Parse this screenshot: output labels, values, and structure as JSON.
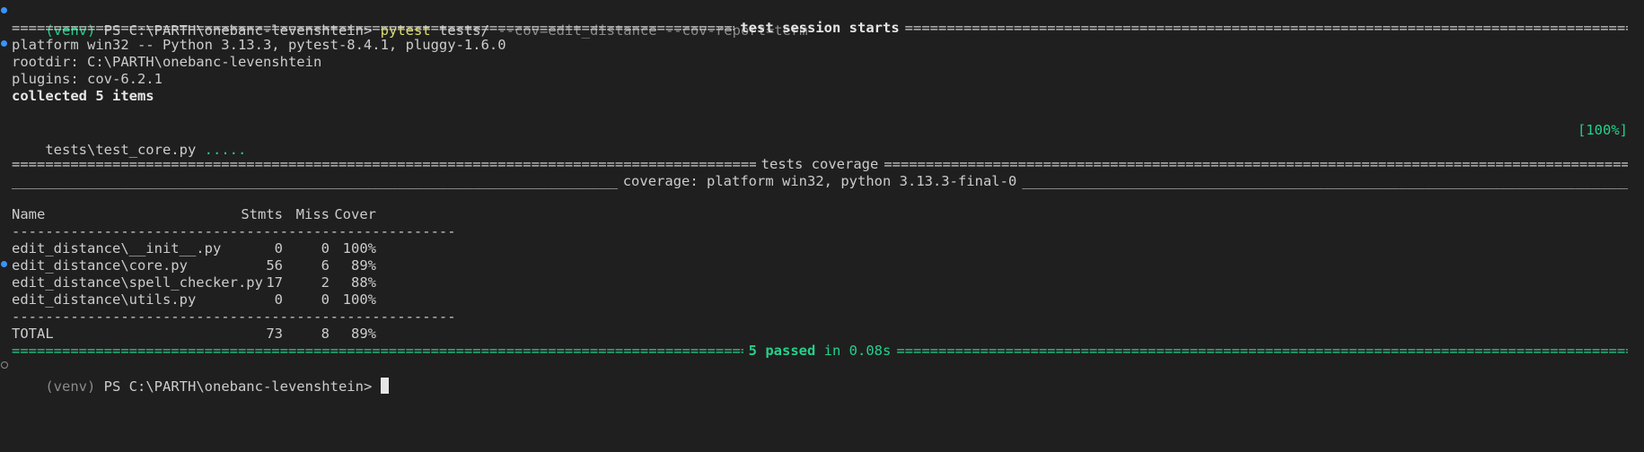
{
  "terminal": {
    "command": {
      "venv": "(venv)",
      "ps_path": "PS C:\\PARTH\\onebanc-levenshtein>",
      "cmd": "pytest",
      "arg": "tests/",
      "opts": "--cov=edit_distance --cov-report=term"
    },
    "session_header": "test session starts",
    "platform_line": "platform win32 -- Python 3.13.3, pytest-8.4.1, pluggy-1.6.0",
    "rootdir_line": "rootdir: C:\\PARTH\\onebanc-levenshtein",
    "plugins_line": "plugins: cov-6.2.1",
    "collected_line": "collected 5 items",
    "test_file": "tests\\test_core.py",
    "test_dots": ".....",
    "progress": "[100%]",
    "coverage_header": "tests coverage",
    "coverage_subheader": "coverage: platform win32, python 3.13.3-final-0",
    "coverage_table": {
      "headers": [
        "Name",
        "Stmts",
        "Miss",
        "Cover"
      ],
      "separator": "-----------------------------------------------------",
      "rows": [
        [
          "edit_distance\\__init__.py",
          "0",
          "0",
          "100%"
        ],
        [
          "edit_distance\\core.py",
          "56",
          "6",
          "89%"
        ],
        [
          "edit_distance\\spell_checker.py",
          "17",
          "2",
          "88%"
        ],
        [
          "edit_distance\\utils.py",
          "0",
          "0",
          "100%"
        ]
      ],
      "total": [
        "TOTAL",
        "73",
        "8",
        "89%"
      ]
    },
    "summary": {
      "passed": "5 passed",
      "time": "in 0.08s"
    },
    "final_prompt": {
      "venv": "(venv)",
      "ps_path": "PS C:\\PARTH\\onebanc-levenshtein>"
    }
  },
  "colors": {
    "background": "#1f1f1f",
    "text": "#cccccc",
    "green": "#23d18b",
    "yellow": "#dcdc6e",
    "dim": "#8b8b8b",
    "marker_blue": "#3794ff"
  }
}
